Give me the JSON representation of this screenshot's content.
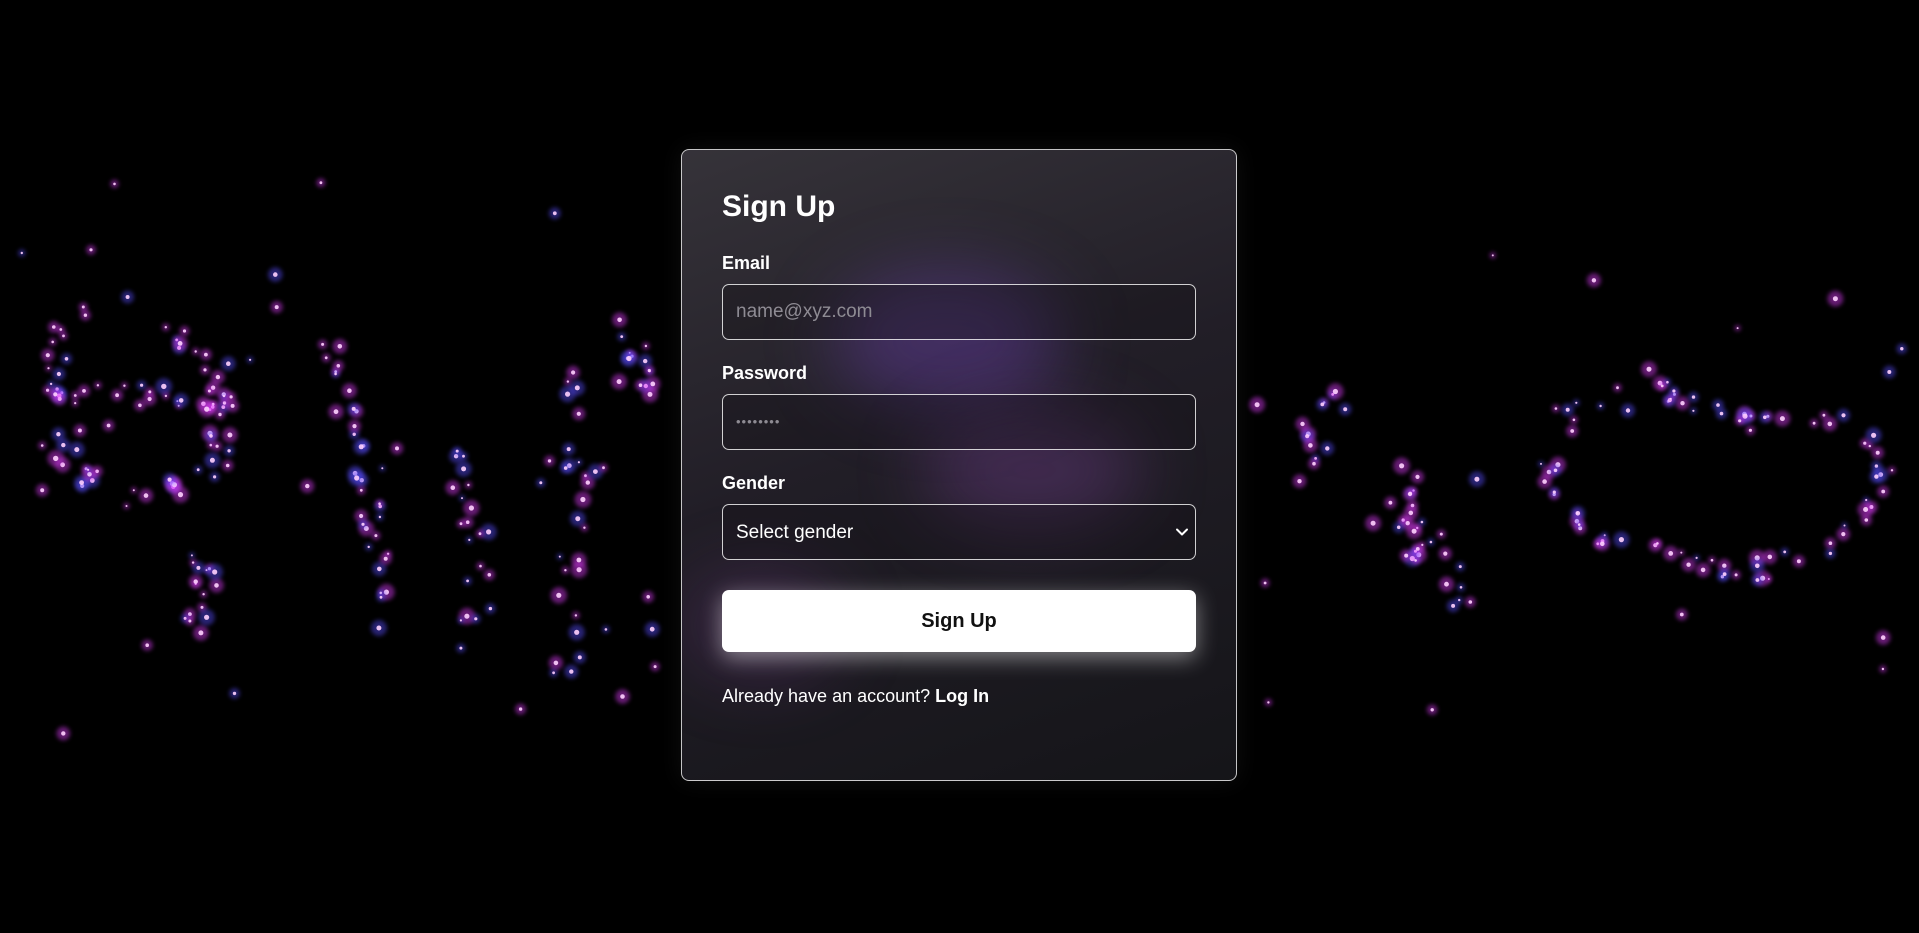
{
  "signup": {
    "title": "Sign Up",
    "email": {
      "label": "Email",
      "placeholder": "name@xyz.com",
      "value": ""
    },
    "password": {
      "label": "Password",
      "masked_value": "••••••••"
    },
    "gender": {
      "label": "Gender",
      "selected": "Select gender"
    },
    "submit_label": "Sign Up",
    "footer": {
      "prompt": "Already have an account?",
      "link_label": "Log In"
    }
  },
  "colors": {
    "background": "#000000",
    "particle_magenta": "#e23cff",
    "particle_blue": "#5a4dff",
    "card_border": "#ffffff",
    "button_bg": "#ffffff",
    "button_text": "#111111"
  }
}
